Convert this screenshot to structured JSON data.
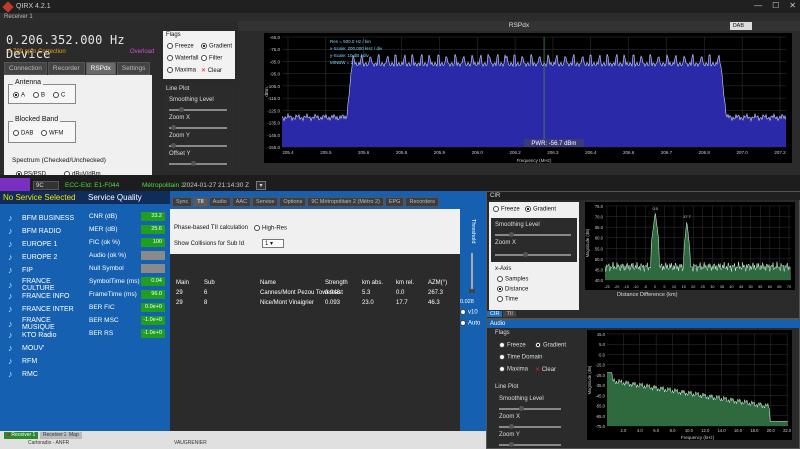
{
  "window": {
    "title": "QIRX 4.2.1",
    "subtitle": "Receiver 1",
    "min": "—",
    "max": "☐",
    "close": "✕"
  },
  "tuner": {
    "frequency": "0.206.352.000 Hz Device",
    "ppm": "-0.799 ppm Correction",
    "overload": "Overload"
  },
  "left_tabs": [
    "Connection",
    "Recorder",
    "RSPdx",
    "Settings"
  ],
  "left_tab_active": 2,
  "antenna": {
    "label": "Antenna",
    "options": [
      "A",
      "B",
      "C"
    ],
    "selected": 0
  },
  "blocked_band": {
    "label": "Blocked Band",
    "options": [
      "DAB",
      "WFM"
    ]
  },
  "spectrum_mode": {
    "label": "Spectrum (Checked/Unchecked)",
    "options": [
      "PS/PSD",
      "dBuV/dBm"
    ]
  },
  "flags": {
    "title": "Flags",
    "freeze": "Freeze",
    "gradient": "Gradient",
    "waterfall": "Waterfall",
    "filter": "Filter",
    "maxima": "Maxima",
    "clear": "Clear"
  },
  "lineplot": {
    "title": "Line Plot",
    "smoothing": "Smoothing Level",
    "zoom_x": "Zoom X",
    "zoom_y": "Zoom Y",
    "offset_y": "Offset Y"
  },
  "spectrum": {
    "title": "RSPdx",
    "mode_select": "DAB",
    "info": [
      "Res = 500.0 Hz / bin",
      "x-Scale: 200,000 kHz / div",
      "y-Scale: 10 dB / div",
      "MINBW = 2"
    ],
    "power": "PWR: -56.7 dBm",
    "ylabel": "dBm",
    "xlabel": "Frequency (MHz)",
    "yticks": [
      "-65.0",
      "-75.0",
      "-85.0",
      "-95.0",
      "-105.0",
      "-115.0",
      "-125.0",
      "-135.0",
      "-145.0",
      "-155.0"
    ],
    "xticks": [
      "205.4",
      "205.5",
      "205.6",
      "205.8",
      "205.9",
      "206.0",
      "206.2",
      "206.3",
      "206.4",
      "206.6",
      "206.7",
      "206.8",
      "207.0",
      "207.2"
    ]
  },
  "ensemble": {
    "channel": "9C",
    "id": "ECC-EId: E1-F044",
    "name": "Métropolitain 2",
    "datetime": "2024-01-27  21:14:30 Z"
  },
  "services": {
    "header": "No Service Selected",
    "items": [
      "BFM BUSINESS",
      "BFM RADIO",
      "EUROPE 1",
      "EUROPE 2",
      "FIP",
      "FRANCE CULTURE",
      "FRANCE INFO",
      "FRANCE INTER",
      "FRANCE MUSIQUE",
      "KTO Radio",
      "MOUV'",
      "RFM",
      "RMC"
    ]
  },
  "quality": {
    "header": "Service Quality",
    "rows": [
      {
        "label": "CNR (dB)",
        "value": "33.2",
        "color": "#1f9e1f"
      },
      {
        "label": "MER (dB)",
        "value": "25.6",
        "color": "#1f9e1f"
      },
      {
        "label": "FIC (ok %)",
        "value": "100",
        "color": "#1f9e1f"
      },
      {
        "label": "Audio (ok %)",
        "value": "",
        "color": "#8a8a8a"
      },
      {
        "label": "Null Symbol",
        "value": "",
        "color": "#8a8a8a"
      },
      {
        "label": "SymbolTime (ms)",
        "value": "0.04",
        "color": "#1f9e1f"
      },
      {
        "label": "FrameTime (ms)",
        "value": "96.0",
        "color": "#1f9e1f"
      },
      {
        "label": "BER FIC",
        "value": "0.0e+0",
        "color": "#1f9e1f"
      },
      {
        "label": "BER MSC",
        "value": "-1.0e+0",
        "color": "#1f9e1f"
      },
      {
        "label": "BER RS",
        "value": "-1.0e+0",
        "color": "#1f9e1f"
      }
    ]
  },
  "center_tabs": [
    "Sync",
    "TII",
    "Audio",
    "AAC",
    "Service",
    "Options",
    "9C Métropolitain 2 (Métro 2)",
    "EPG",
    "Recorders"
  ],
  "center_tab_active": 1,
  "tii": {
    "phase_label": "Phase-based TII calculation",
    "high_res": "High-Res",
    "collisions_label": "Show Collisions for Sub Id",
    "collisions_value": "1",
    "threshold_label": "Threshold",
    "threshold_value": "0.028",
    "v10": "v10",
    "auto": "Auto",
    "headers": [
      "Main",
      "Sub",
      "Name",
      "Strength",
      "km abs.",
      "km rel.",
      "AZM(°)"
    ],
    "rows": [
      [
        "29",
        "6",
        "Cannes/Mont Pezou Towercast",
        "0.948",
        "5.3",
        "0.0",
        "267.3"
      ],
      [
        "29",
        "8",
        "Nice/Mont Vinaigrier",
        "0.093",
        "23.0",
        "17.7",
        "46.3"
      ]
    ]
  },
  "cir": {
    "title": "CIR",
    "freeze": "Freeze",
    "gradient": "Gradient",
    "smoothing": "Smoothing Level",
    "zoom_x": "Zoom X",
    "xaxis_title": "x-Axis",
    "xaxis_options": [
      "Samples",
      "Distance",
      "Time"
    ],
    "ylabel": "Magnitude (dB)",
    "xlabel": "Distance Difference (km)",
    "peak1": "0.0",
    "peak2": "17.7",
    "yticks": [
      "75.0",
      "70.0",
      "65.0",
      "60.0",
      "55.0",
      "50.0",
      "45.0",
      "40.0"
    ],
    "xticks": [
      "-25",
      "-20",
      "-15",
      "-10",
      "-5",
      "0",
      "5",
      "10",
      "15",
      "20",
      "25",
      "30",
      "35",
      "40",
      "45",
      "50",
      "55",
      "60",
      "65",
      "70"
    ],
    "tabs": [
      "CIR",
      "TII"
    ]
  },
  "audio": {
    "title": "Audio",
    "flags": "Flags",
    "freeze": "Freeze",
    "gradient": "Gradient",
    "timedomain": "Time Domain",
    "maxima": "Maxima",
    "clear": "Clear",
    "lineplot": "Line Plot",
    "smoothing": "Smoothing Level",
    "zoom_x": "Zoom X",
    "zoom_y": "Zoom Y",
    "ylabel": "Magnitude (dB)",
    "xlabel": "Frequency (kHz)",
    "yticks": [
      "15.0",
      "5.0",
      "-5.0",
      "-15.0",
      "-25.0",
      "-35.0",
      "-45.0",
      "-55.0",
      "-65.0",
      "-75.0"
    ],
    "xticks": [
      "2.0",
      "4.0",
      "6.0",
      "8.0",
      "10.0",
      "12.0",
      "14.0",
      "16.0",
      "18.0",
      "20.0",
      "22.0"
    ]
  },
  "statusbar": {
    "receivers": [
      "Receiver 1",
      "Receiver 2",
      "Map"
    ],
    "map_credit": "Cartoradio - ANFR",
    "place": "VAUGRENIER"
  }
}
